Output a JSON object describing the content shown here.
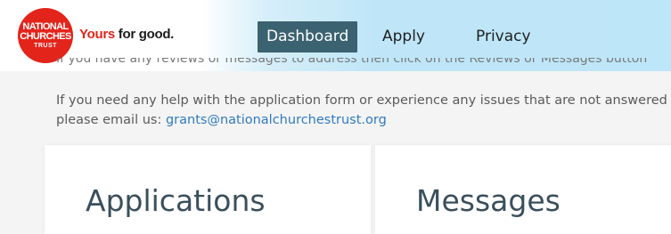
{
  "brand": {
    "logo_line1": "NATIONAL",
    "logo_line2": "CHURCHES",
    "logo_line3": "TRUST",
    "tagline_part1": "Yours",
    "tagline_part2": " for good.",
    "colors": {
      "brand_red": "#e3241b",
      "nav_active_bg": "#3b6270",
      "header_blue": "#bfe6f8",
      "link_blue": "#2f7bbf"
    }
  },
  "nav": {
    "dashboard": "Dashboard",
    "apply": "Apply",
    "privacy": "Privacy",
    "active": "Dashboard"
  },
  "content": {
    "cutoff_text": "If you have any reviews or messages to address then click on the Reviews or Messages button",
    "help_line1": "If you need any help with the application form or experience any issues that are not answered",
    "help_line2_prefix": "please email us: ",
    "help_email": "grants@nationalchurchestrust.org"
  },
  "cards": {
    "applications_title": "Applications",
    "messages_title": "Messages"
  }
}
